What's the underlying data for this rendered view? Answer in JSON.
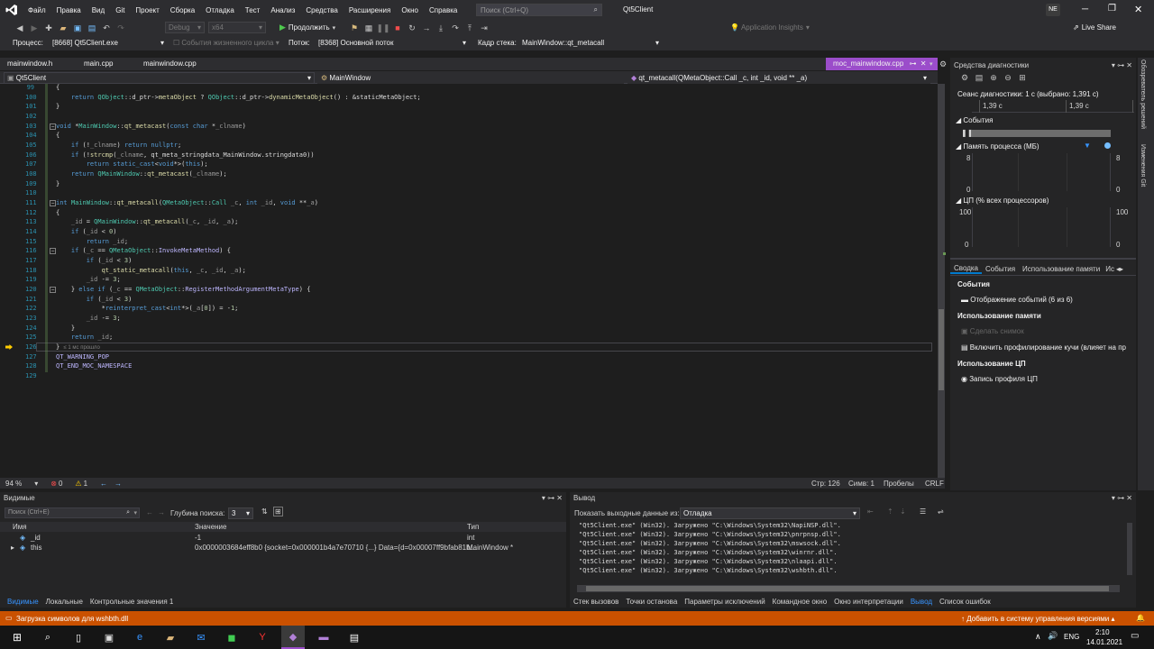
{
  "menu": {
    "items": [
      "Файл",
      "Правка",
      "Вид",
      "Git",
      "Проект",
      "Сборка",
      "Отладка",
      "Тест",
      "Анализ",
      "Средства",
      "Расширения",
      "Окно",
      "Справка"
    ],
    "search_placeholder": "Поиск (Ctrl+Q)",
    "solution_name": "Qt5Client",
    "user_initials": "NE",
    "live_share": "Live Share"
  },
  "toolbar": {
    "config": "Debug",
    "platform": "x64",
    "continue_label": "Продолжить",
    "insights": "Application Insights"
  },
  "debugbar": {
    "process_label": "Процесс:",
    "process_value": "[8668] Qt5Client.exe",
    "lifecycle": "События жизненного цикла",
    "thread_label": "Поток:",
    "thread_value": "[8368] Основной поток",
    "frame_label": "Кадр стека:",
    "frame_value": "MainWindow::qt_metacall"
  },
  "tabs": {
    "t1": "mainwindow.h",
    "t2": "main.cpp",
    "t3": "mainwindow.cpp",
    "active": "moc_mainwindow.cpp"
  },
  "navbar": {
    "project": "Qt5Client",
    "scope": "MainWindow",
    "member": "qt_metacall(QMetaObject::Call _c, int _id, void ** _a)"
  },
  "editor": {
    "lines": [
      "99",
      "100",
      "101",
      "102",
      "103",
      "104",
      "105",
      "106",
      "107",
      "108",
      "109",
      "110",
      "111",
      "112",
      "113",
      "114",
      "115",
      "116",
      "117",
      "118",
      "119",
      "120",
      "121",
      "122",
      "123",
      "124",
      "125",
      "126",
      "127",
      "128",
      "129"
    ],
    "elapsed_hint": "≤ 1 мс прошло",
    "zoom": "94 %",
    "errors": "0",
    "warnings": "1",
    "pos_line": "Стр: 126",
    "pos_char": "Симв: 1",
    "spaces": "Пробелы",
    "eol": "CRLF"
  },
  "diagnostics": {
    "title": "Средства диагностики",
    "session": "Сеанс диагностики: 1 с (выбрано: 1,391 с)",
    "ruler_a": "1,39 с",
    "ruler_b": "1,39 с",
    "events_header": "События",
    "memory_header": "Память процесса (МБ)",
    "mem_max": "8",
    "mem_min": "0",
    "cpu_header": "ЦП (% всех процессоров)",
    "cpu_max": "100",
    "cpu_min": "0",
    "tabs": [
      "Сводка",
      "События",
      "Использование памяти",
      "Ис"
    ],
    "sec_events": "События",
    "show_events": "Отображение событий (6 из 6)",
    "sec_memory": "Использование памяти",
    "snapshot": "Сделать снимок",
    "heap": "Включить профилирование кучи (влияет на пр",
    "sec_cpu": "Использование ЦП",
    "cpu_profile": "Запись профиля ЦП",
    "side_a": "Обозреватель решений",
    "side_b": "Изменения Git"
  },
  "locals": {
    "title": "Видимые",
    "search_placeholder": "Поиск (Ctrl+E)",
    "depth_label": "Глубина поиска:",
    "depth_value": "3",
    "columns": [
      "Имя",
      "Значение",
      "Тип"
    ],
    "rows": [
      {
        "name": "_id",
        "value": "-1",
        "type": "int"
      },
      {
        "name": "this",
        "value": "0x0000003684eff8b0 {socket=0x000001b4a7e70710 {...} Data={d=0x00007ff9bfab81b...",
        "type": "MainWindow *"
      }
    ],
    "tabs": [
      "Видимые",
      "Локальные",
      "Контрольные значения 1"
    ]
  },
  "output": {
    "title": "Вывод",
    "show_from": "Показать выходные данные из:",
    "source": "Отладка",
    "lines": [
      "\"Qt5Client.exe\" (Win32). Загружено \"C:\\Windows\\System32\\NapiNSP.dll\".",
      "\"Qt5Client.exe\" (Win32). Загружено \"C:\\Windows\\System32\\pnrpnsp.dll\".",
      "\"Qt5Client.exe\" (Win32). Загружено \"C:\\Windows\\System32\\mswsock.dll\".",
      "\"Qt5Client.exe\" (Win32). Загружено \"C:\\Windows\\System32\\winrnr.dll\".",
      "\"Qt5Client.exe\" (Win32). Загружено \"C:\\Windows\\System32\\nlaapi.dll\".",
      "\"Qt5Client.exe\" (Win32). Загружено \"C:\\Windows\\System32\\wshbth.dll\"."
    ],
    "tabs": [
      "Стек вызовов",
      "Точки останова",
      "Параметры исключений",
      "Командное окно",
      "Окно интерпретации",
      "Вывод",
      "Список ошибок"
    ]
  },
  "status": {
    "message": "Загрузка символов для wshbth.dll",
    "vcs": "Добавить в систему управления версиями"
  },
  "taskbar": {
    "lang": "ENG",
    "time": "2:10",
    "date": "14.01.2021"
  },
  "colors": {
    "accent": "#ca5100",
    "tab_active": "#9b4dca",
    "vs_purple": "#68217a",
    "breakpoint_yellow": "#ffcc00"
  }
}
